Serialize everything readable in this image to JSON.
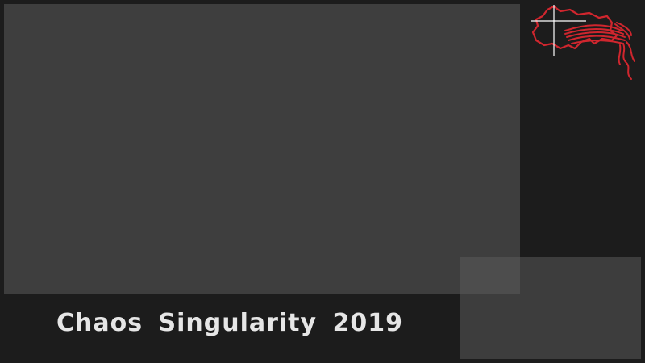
{
  "stream": {
    "title": "Chaos Singularity 2019"
  },
  "logo": {
    "icon": "swiss-map-cable-logo-icon",
    "accent_color": "#d0262e",
    "crosshair_color": "#ffffff"
  },
  "colors": {
    "background": "#1c1c1c",
    "main_video": "#3e3e3e",
    "speaker_video": "#5a5a5a",
    "title_text": "#e6e6e6"
  }
}
